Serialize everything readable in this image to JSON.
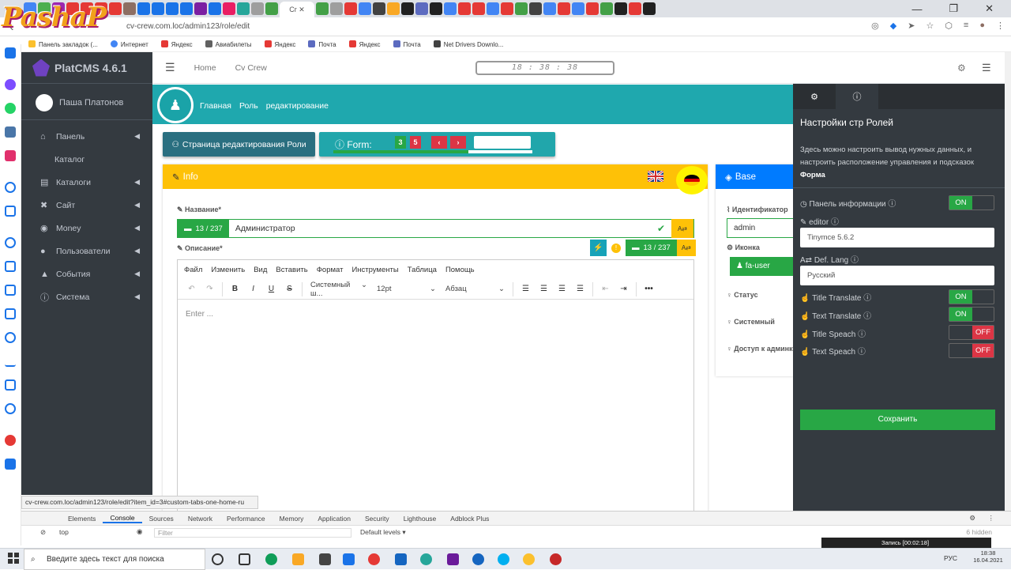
{
  "browser": {
    "url": "cv-crew.com.loc/admin123/role/edit",
    "bookmarks": [
      "Панель закладок (...",
      "Интернет",
      "Яндекс",
      "Авиабилеты",
      "Яндекс",
      "Почта",
      "Яндекс",
      "Почта",
      "Net Drivers Downlo..."
    ],
    "status_url": "cv-crew.com.loc/admin123/role/edit?item_id=3#custom-tabs-one-home-ru",
    "watermark": "PashaP"
  },
  "sidebar": {
    "brand": "PlatCMS 4.6.1",
    "user": "Паша Платонов",
    "items": [
      {
        "label": "Панель",
        "icon": "home-icon"
      },
      {
        "label": "Каталог",
        "icon": ""
      },
      {
        "label": "Каталоги",
        "icon": "book-icon"
      },
      {
        "label": "Сайт",
        "icon": "tools-icon"
      },
      {
        "label": "Money",
        "icon": "coins-icon"
      },
      {
        "label": "Пользователи",
        "icon": "user-circle-icon"
      },
      {
        "label": "События",
        "icon": "bell-icon"
      },
      {
        "label": "Система",
        "icon": "info-icon"
      }
    ]
  },
  "topbar": {
    "home": "Home",
    "crew": "Cv Crew",
    "clock": "18 : 38 : 38"
  },
  "breadcrumb": [
    "Главная",
    "Роль",
    "редактирование"
  ],
  "buttons": {
    "role_page": "Страница редактирования Роли",
    "form_label": "Form:",
    "form_a": "3",
    "form_b": "5",
    "prev": "‹",
    "next": "›",
    "form_progress": 0.68
  },
  "info": {
    "title": "Info",
    "name_label": "Название*",
    "name_counter": "13 / 237",
    "name_value": "Администратор",
    "desc_label": "Описание*",
    "desc_counter": "13 / 237",
    "editor_menu": [
      "Файл",
      "Изменить",
      "Вид",
      "Вставить",
      "Формат",
      "Инструменты",
      "Таблица",
      "Помощь"
    ],
    "font_select": "Системный ш...",
    "size_select": "12pt",
    "block_select": "Абзац",
    "placeholder": "Enter ..."
  },
  "base": {
    "title": "Base",
    "id_label": "Идентификатор",
    "id_value": "admin",
    "icon_label": "Иконка",
    "icon_value": "fa-user",
    "status_label": "Статус",
    "system_label": "Системный",
    "access_label": "Доступ к админке"
  },
  "settings": {
    "title": "Настройки стр Ролей",
    "desc": "Здесь можно настроить вывод нужных данных, и настроить расположение управления и подсказок",
    "desc_bold": "Форма",
    "info_panel": "Панель информации",
    "editor": "editor",
    "editor_value": "Tinymce 5.6.2",
    "def_lang": "Def. Lang",
    "def_lang_value": "Русский",
    "title_translate": "Title Translate",
    "text_translate": "Text Translate",
    "title_speach": "Title Speach",
    "text_speach": "Text Speach",
    "on": "ON",
    "off": "OFF",
    "save": "Сохранить"
  },
  "devtools": {
    "tabs": [
      "Elements",
      "Console",
      "Sources",
      "Network",
      "Performance",
      "Memory",
      "Application",
      "Security",
      "Lighthouse",
      "Adblock Plus"
    ],
    "context": "top",
    "filter_placeholder": "Filter",
    "levels": "Default levels ▾",
    "hidden": "6 hidden"
  },
  "taskbar": {
    "search": "Введите здесь текст для поиска",
    "lang": "РУС",
    "time": "18:38",
    "date": "16.04.2021",
    "recording": "Запись [00:02:18]"
  }
}
